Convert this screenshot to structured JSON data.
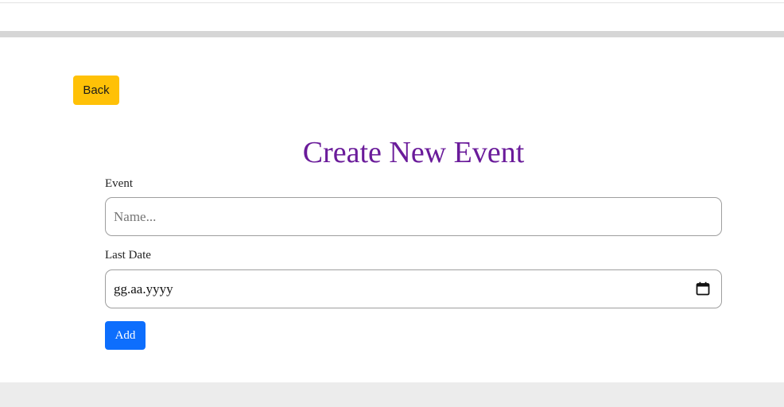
{
  "toolbar": {
    "back_label": "Back"
  },
  "form": {
    "title": "Create New Event",
    "event_label": "Event",
    "event_placeholder": "Name...",
    "event_value": "",
    "date_label": "Last Date",
    "date_value": "gg.aa.yyyy",
    "add_label": "Add"
  },
  "icons": {
    "date_picker": "calendar-icon"
  },
  "colors": {
    "back_button": "#ffc107",
    "title": "#6a1b9a",
    "add_button": "#0d6efd",
    "footer": "#ececec",
    "band": "#d6d6d6"
  }
}
